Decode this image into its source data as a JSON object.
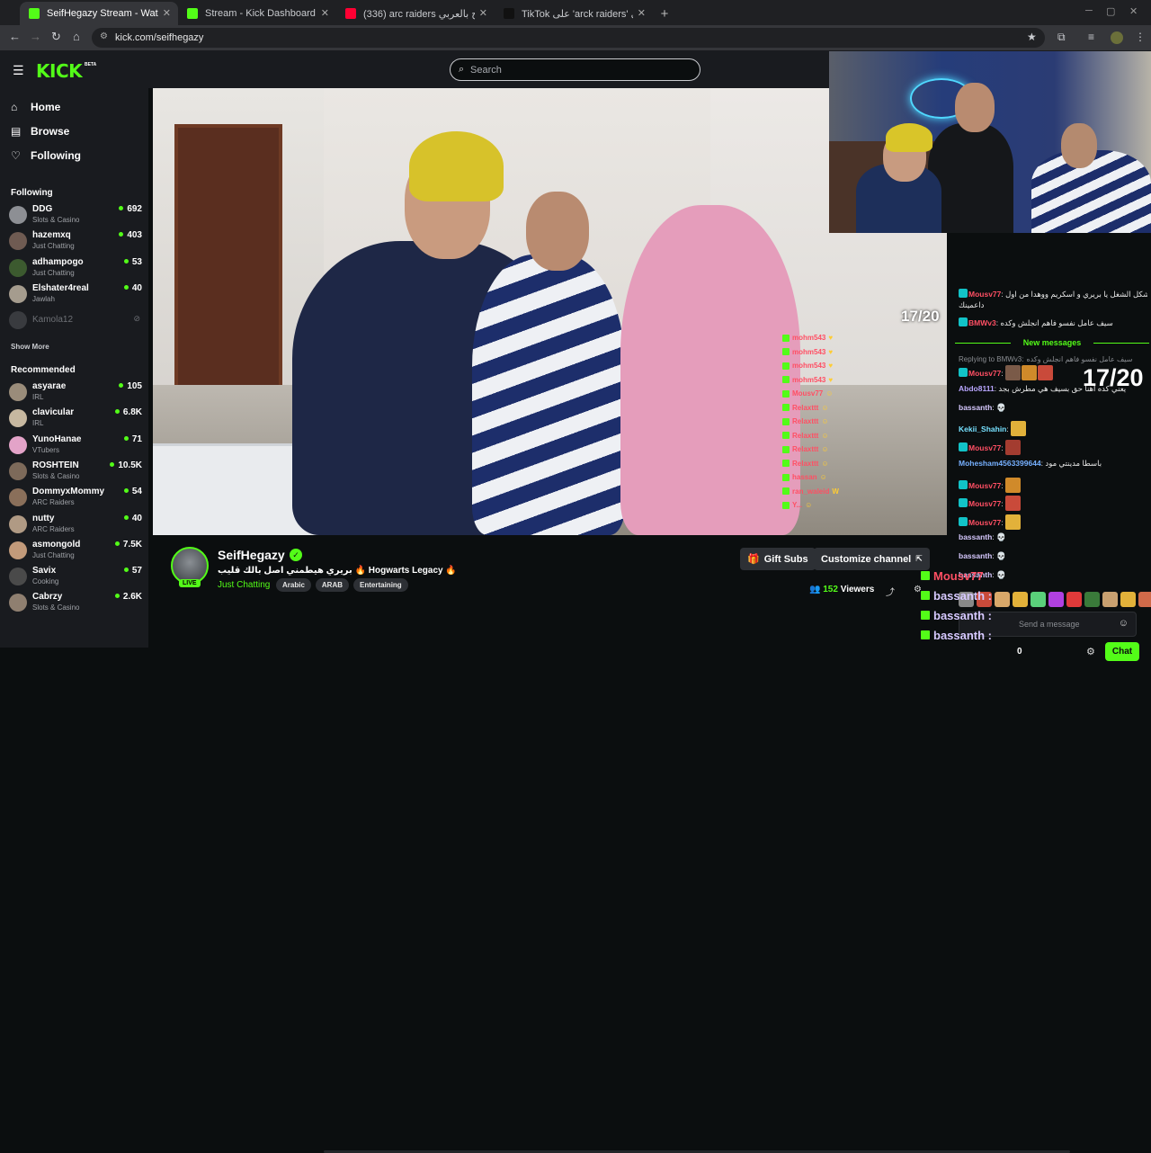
{
  "browser": {
    "tabs": [
      {
        "title": "SeifHegazy Stream - Watch",
        "active": true,
        "favicon_color": "#53fc18"
      },
      {
        "title": "Stream - Kick Dashboard",
        "active": false,
        "favicon_color": "#53fc18"
      },
      {
        "title": "(336) arc raiders شرح بالعربي - Y",
        "active": false,
        "favicon_color": "#ff0033"
      },
      {
        "title": "TikTok على 'arck raiders' اعثر على",
        "active": false,
        "favicon_color": "#111111"
      }
    ],
    "new_tab": "+",
    "url": "kick.com/seifhegazy"
  },
  "kick": {
    "logo": "KICK",
    "beta": "BETA",
    "search_placeholder": "Search",
    "nav": [
      {
        "label": "Home",
        "icon": "home-icon",
        "glyph": "⌂"
      },
      {
        "label": "Browse",
        "icon": "browse-icon",
        "glyph": "▤"
      },
      {
        "label": "Following",
        "icon": "heart-icon",
        "glyph": "♡"
      }
    ],
    "following_title": "Following",
    "following": [
      {
        "name": "DDG",
        "category": "Slots & Casino",
        "viewers": "692",
        "avatar": "#8d8f94"
      },
      {
        "name": "hazemxq",
        "category": "Just Chatting",
        "viewers": "403",
        "avatar": "#6f5b52"
      },
      {
        "name": "adhampogo",
        "category": "Just Chatting",
        "viewers": "53",
        "avatar": "#3c5a2f"
      },
      {
        "name": "Elshater4real",
        "category": "Jawlah",
        "viewers": "40",
        "avatar": "#a59c8e"
      },
      {
        "name": "Kamola12",
        "category": "",
        "viewers": "",
        "avatar": "#5a5c60",
        "offline": true
      }
    ],
    "show_more": "Show More",
    "recommended_title": "Recommended",
    "recommended": [
      {
        "name": "asyarae",
        "category": "IRL",
        "viewers": "105",
        "avatar": "#9a8c7a"
      },
      {
        "name": "clavicular",
        "category": "IRL",
        "viewers": "6.8K",
        "avatar": "#c7b8a0"
      },
      {
        "name": "YunoHanae",
        "category": "VTubers",
        "viewers": "71",
        "avatar": "#e3a3c8"
      },
      {
        "name": "ROSHTEIN",
        "category": "Slots & Casino",
        "viewers": "10.5K",
        "avatar": "#7d6a5a"
      },
      {
        "name": "DommyxMommy",
        "category": "ARC Raiders",
        "viewers": "54",
        "avatar": "#8a6f5a"
      },
      {
        "name": "nutty",
        "category": "ARC Raiders",
        "viewers": "40",
        "avatar": "#b09a84"
      },
      {
        "name": "asmongold",
        "category": "Just Chatting",
        "viewers": "7.5K",
        "avatar": "#c29a7a"
      },
      {
        "name": "Savix",
        "category": "Cooking",
        "viewers": "57",
        "avatar": "#4a4a4a"
      },
      {
        "name": "Cabrzy",
        "category": "Slots & Casino",
        "viewers": "2.6K",
        "avatar": "#8f7f70"
      }
    ]
  },
  "video": {
    "counter": "17/20",
    "overlay_chat": [
      {
        "user": "mohm543",
        "emote": "♥"
      },
      {
        "user": "mohm543",
        "emote": "♥"
      },
      {
        "user": "mohm543",
        "emote": "♥"
      },
      {
        "user": "mohm543",
        "emote": "♥"
      },
      {
        "user": "Mousv77",
        "emote": "☺"
      },
      {
        "user": "Relaxttt",
        "emote": "☺"
      },
      {
        "user": "Relaxttt",
        "emote": "☺"
      },
      {
        "user": "Relaxttt",
        "emote": "☺"
      },
      {
        "user": "Relaxttt",
        "emote": "☺"
      },
      {
        "user": "Relaxttt",
        "emote": "☺"
      },
      {
        "user": "hassan",
        "emote": "☺"
      },
      {
        "user": "ran_waleid",
        "emote": "W"
      },
      {
        "user": "Y...",
        "emote": "☺"
      }
    ]
  },
  "stream": {
    "name": "SeifHegazy",
    "live": "LIVE",
    "title": "بريري هيطمني اصل بالك قليب 🔥 Hogwarts Legacy 🔥",
    "category": "Just Chatting",
    "tags": [
      "Arabic",
      "ARAB",
      "Entertaining"
    ],
    "gift_subs": "Gift Subs",
    "customize": "Customize channel",
    "viewers_count": "152",
    "viewers_label": "Viewers"
  },
  "chat": {
    "new_messages": "New messages",
    "replying_to": "Replying to BMWv3:",
    "reply_quote": "سيف عامل نفسو فاهم انجلش وكده",
    "counter": "17/20",
    "messages": [
      {
        "user": "Mousv77",
        "color": "#ff4f64",
        "text": "شكل الشغل يا بريري و اسكريم ووهدا من اول",
        "badge": "b-t"
      },
      {
        "user": "",
        "color": "#e8e8e8",
        "text": "داعمينك",
        "badge": ""
      },
      {
        "user": "BMWv3",
        "color": "#ff4f64",
        "text": "سيف عامل نفسو فاهم انجلش وكده",
        "badge": "b-t"
      },
      {
        "user": "Mousv77",
        "color": "#ff4f64",
        "text": "",
        "badge": "b-t",
        "emotes": 3
      },
      {
        "user": "Abdo8111",
        "color": "#b9a6ff",
        "text": "يعني كده اهنا حق بسيف هي مطرش بجد",
        "badge": ""
      },
      {
        "user": "bassanth",
        "color": "#d7c9ff",
        "text": "💀",
        "badge": ""
      },
      {
        "user": "Kekii_Shahin",
        "color": "#76e1ff",
        "text": "",
        "badge": "",
        "emotes": 1
      },
      {
        "user": "Mousv77",
        "color": "#ff4f64",
        "text": "",
        "badge": "b-t",
        "emotes": 1
      },
      {
        "user": "Mohesham4563399644",
        "color": "#76b0ff",
        "text": "باسطا مدينتي مود",
        "badge": ""
      },
      {
        "user": "Mousv77",
        "color": "#ff4f64",
        "text": "",
        "badge": "b-t",
        "emotes": 1
      },
      {
        "user": "Mousv77",
        "color": "#ff4f64",
        "text": "",
        "badge": "b-t",
        "emotes": 1
      },
      {
        "user": "Mousv77",
        "color": "#ff4f64",
        "text": "",
        "badge": "b-t",
        "emotes": 1
      },
      {
        "user": "bassanth",
        "color": "#d7c9ff",
        "text": "💀",
        "badge": ""
      },
      {
        "user": "bassanth",
        "color": "#d7c9ff",
        "text": "💀",
        "badge": ""
      },
      {
        "user": "bassanth",
        "color": "#d7c9ff",
        "text": "💀",
        "badge": ""
      }
    ],
    "input_placeholder": "Send a message",
    "chat_button": "Chat",
    "points": "0",
    "ghost_lines": [
      {
        "user": "Mousv77",
        "color": "#ff4f64"
      },
      {
        "user": "bassanth :",
        "color": "#d7c9ff"
      },
      {
        "user": "bassanth :",
        "color": "#d7c9ff"
      },
      {
        "user": "bassanth :",
        "color": "#d7c9ff"
      }
    ]
  },
  "colors": {
    "accent": "#53fc18",
    "background": "#0b0e0f",
    "panel": "#191b1f"
  }
}
